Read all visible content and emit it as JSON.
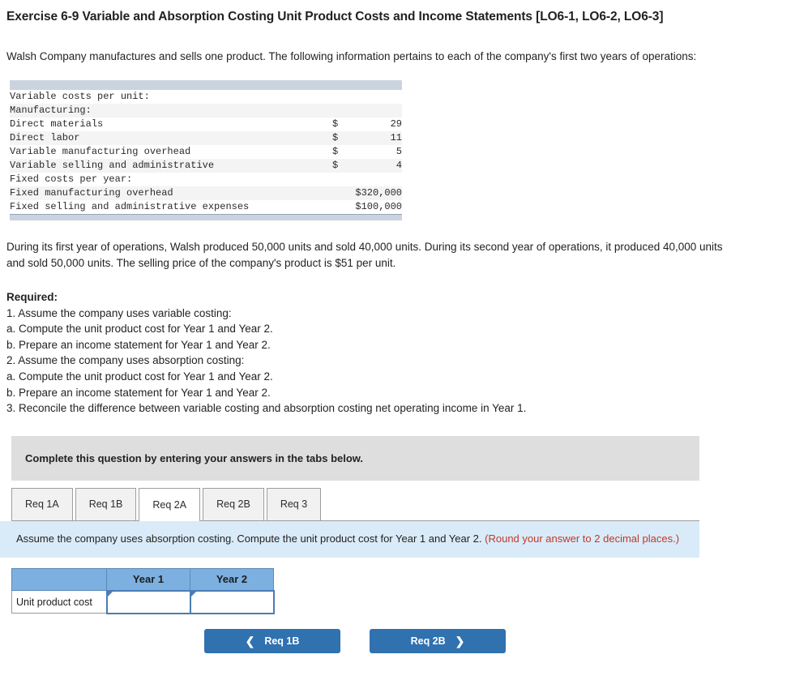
{
  "title": "Exercise 6-9 Variable and Absorption Costing Unit Product Costs and Income Statements [LO6-1, LO6-2, LO6-3]",
  "intro": "Walsh Company manufactures and sells one product. The following information pertains to each of the company's first two years of operations:",
  "fact_table": {
    "rows": [
      {
        "label": "Variable costs per unit:",
        "indent": 0,
        "currency": "",
        "value": "",
        "alt": false
      },
      {
        "label": "Manufacturing:",
        "indent": 1,
        "currency": "",
        "value": "",
        "alt": true
      },
      {
        "label": "Direct materials",
        "indent": 2,
        "currency": "$",
        "value": "29",
        "alt": false
      },
      {
        "label": "Direct labor",
        "indent": 2,
        "currency": "$",
        "value": "11",
        "alt": true
      },
      {
        "label": "Variable manufacturing overhead",
        "indent": 2,
        "currency": "$",
        "value": "5",
        "alt": false
      },
      {
        "label": "Variable selling and administrative",
        "indent": 1,
        "currency": "$",
        "value": "4",
        "alt": true
      },
      {
        "label": "Fixed costs per year:",
        "indent": 0,
        "currency": "",
        "value": "",
        "alt": false
      },
      {
        "label": "Fixed manufacturing overhead",
        "indent": 1,
        "currency": "",
        "value": "$320,000",
        "alt": true
      },
      {
        "label": "Fixed selling and administrative expenses",
        "indent": 1,
        "currency": "",
        "value": "$100,000",
        "alt": false
      }
    ]
  },
  "para2": "During its first year of operations, Walsh produced 50,000 units and sold 40,000 units. During its second year of operations, it produced 40,000 units and sold 50,000 units. The selling price of the company's product is $51 per unit.",
  "required": {
    "heading": "Required:",
    "items": [
      "1. Assume the company uses variable costing:",
      "a. Compute the unit product cost for Year 1 and Year 2.",
      "b. Prepare an income statement for Year 1 and Year 2.",
      "2. Assume the company uses absorption costing:",
      "a. Compute the unit product cost for Year 1 and Year 2.",
      "b. Prepare an income statement for Year 1 and Year 2.",
      "3. Reconcile the difference between variable costing and absorption costing net operating income in Year 1."
    ]
  },
  "complete_bar": {
    "text": "Complete this question by entering your answers in the tabs below."
  },
  "tabs": [
    {
      "label": "Req 1A",
      "active": false
    },
    {
      "label": "Req 1B",
      "active": false
    },
    {
      "label": "Req 2A",
      "active": true
    },
    {
      "label": "Req 2B",
      "active": false
    },
    {
      "label": "Req 3",
      "active": false
    }
  ],
  "instruction": {
    "main": "Assume the company uses absorption costing. Compute the unit product cost for Year 1 and Year 2. ",
    "note": "(Round your answer to 2 decimal places.)"
  },
  "answer_table": {
    "corner_header": "",
    "columns": [
      "Year 1",
      "Year 2"
    ],
    "rows": [
      {
        "label": "Unit product cost",
        "values": [
          "",
          ""
        ]
      }
    ]
  },
  "nav": {
    "prev_label": "Req 1B",
    "prev_icon": "chevron-left",
    "next_label": "Req 2B",
    "next_icon": "chevron-right"
  },
  "colors": {
    "accent_blue": "#3071b0",
    "table_header_blue": "#7cb0e0",
    "instruction_blue": "#d9ebf8",
    "grey_bar": "#dedede",
    "fact_bar": "#ccd3e0",
    "red_note": "#c0392b"
  }
}
